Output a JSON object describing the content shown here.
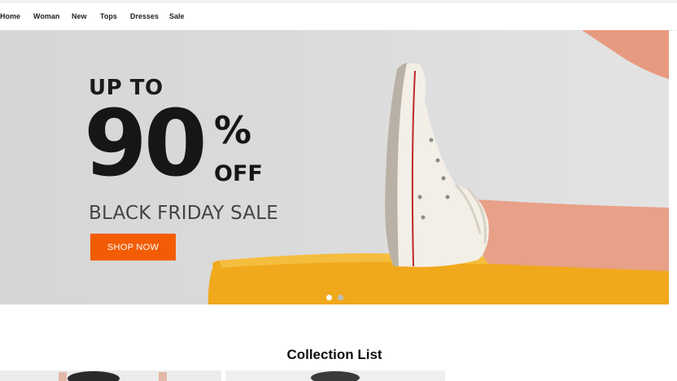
{
  "nav": {
    "items": [
      {
        "label": "Home"
      },
      {
        "label": "Woman"
      },
      {
        "label": "New"
      },
      {
        "label": "Tops"
      },
      {
        "label": "Dresses"
      },
      {
        "label": "Sale"
      }
    ]
  },
  "hero": {
    "line1": "UP TO",
    "big_number": "90",
    "percent": "%",
    "off": "OFF",
    "subtitle": "BLACK FRIDAY SALE",
    "button_label": "SHOP NOW",
    "accent_color": "#f25c05",
    "slides": {
      "current": 1,
      "total": 2
    }
  },
  "collection": {
    "title": "Collection List"
  },
  "colors": {
    "cushion": "#f2a900",
    "skin": "#e8a088",
    "sneaker": "#f3efe6"
  }
}
